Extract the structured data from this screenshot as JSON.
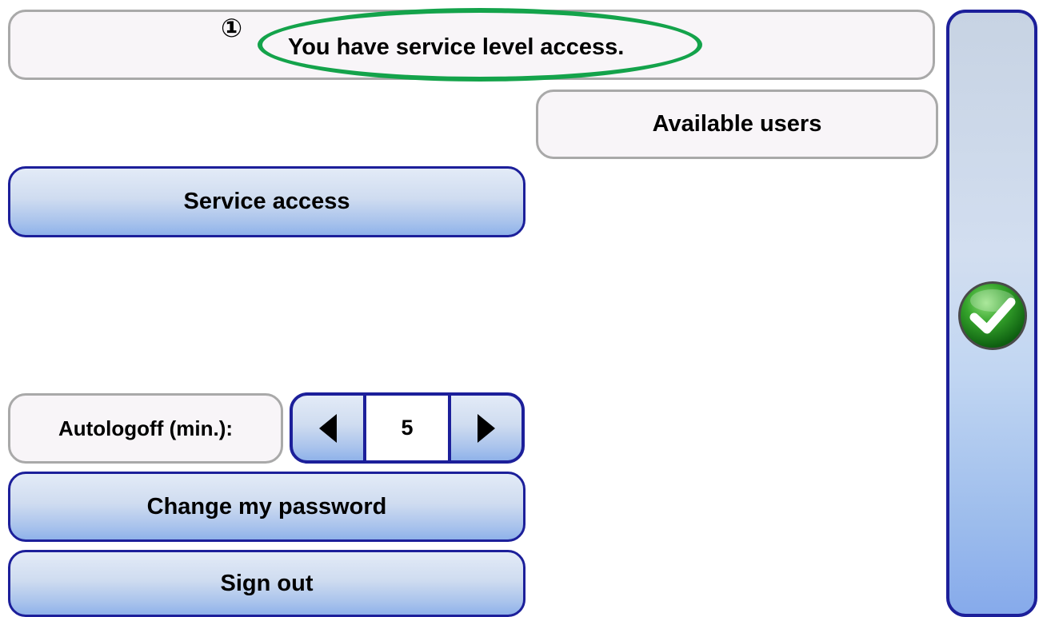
{
  "status": {
    "message": "You have service level access.",
    "callout": "①"
  },
  "users": {
    "header_label": "Available users"
  },
  "buttons": {
    "service_access": "Service access",
    "change_password": "Change my password",
    "sign_out": "Sign out"
  },
  "autologoff": {
    "label": "Autologoff (min.):",
    "value": "5",
    "decrement_icon": "triangle-left-icon",
    "increment_icon": "triangle-right-icon"
  },
  "confirm": {
    "icon": "green-checkmark-icon"
  },
  "colors": {
    "highlight": "#14a34b",
    "button_border": "#1c1f9a",
    "panel_border": "#a9a9a9"
  }
}
